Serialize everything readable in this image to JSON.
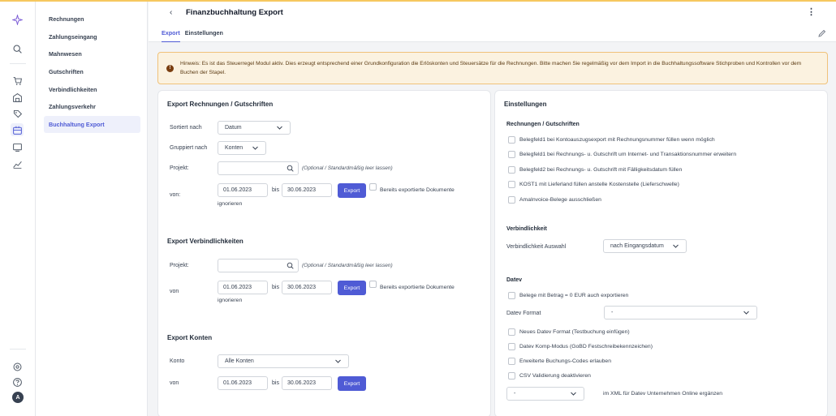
{
  "sidebar": {
    "items": [
      "Rechnungen",
      "Zahlungseingang",
      "Mahnwesen",
      "Gutschriften",
      "Verbindlichkeiten",
      "Zahlungsverkehr",
      "Buchhaltung Export"
    ],
    "active_index": 6,
    "avatar_initial": "A"
  },
  "header": {
    "back": "‹",
    "title": "Finanzbuchhaltung Export",
    "menu": "⋮"
  },
  "tabs": [
    "Export",
    "Einstellungen"
  ],
  "hint": {
    "text": "Hinweis: Es ist das Steuerregel Modul aktiv. Dies erzeugt entsprechend einer Grundkonfiguration die Erlöskonten und Steuersätze für die Rechnungen. Bitte machen Sie regelmäßig vor dem Import in die Buchhaltungssoftware Stichproben und Kontrollen vor dem Buchen der Stapel."
  },
  "export_invoices": {
    "title": "Export Rechnungen / Gutschriften",
    "sort_label": "Sortiert nach",
    "sort_value": "Datum",
    "group_label": "Gruppiert nach",
    "group_value": "Konten",
    "project_label": "Projekt:",
    "project_hint": "(Optional / Standardmäßig leer lassen)",
    "from_label": "von:",
    "from_date": "01.06.2023",
    "to_label": "bis",
    "to_date": "30.06.2023",
    "export_button": "Export",
    "ignore_line1": "Bereits exportierte Dokumente",
    "ignore_line2": "ignorieren"
  },
  "export_liabilities": {
    "title": "Export Verbindlichkeiten",
    "project_label": "Projekt:",
    "project_hint": "(Optional / Standardmäßig leer lassen)",
    "from_label": "von",
    "from_date": "01.06.2023",
    "to_label": "bis",
    "to_date": "30.06.2023",
    "export_button": "Export",
    "ignore_line1": "Bereits exportierte Dokumente",
    "ignore_line2": "ignorieren"
  },
  "export_accounts": {
    "title": "Export Konten",
    "account_label": "Konto",
    "account_value": "Alle Konten",
    "from_label": "von",
    "from_date": "01.06.2023",
    "to_label": "bis",
    "to_date": "30.06.2023",
    "export_button": "Export"
  },
  "settings": {
    "title": "Einstellungen",
    "invoices_heading": "Rechnungen / Gutschriften",
    "invoice_options": [
      "Belegfeld1 bei Kontoauszugsexport mit Rechnungsnummer füllen wenn möglich",
      "Belegfeld1 bei Rechnungs- u. Gutschrift um Internet- und Transaktionsnummer erweitern",
      "Belegfeld2 bei Rechnungs- u. Gutschrift mit Fälligkeitsdatum füllen",
      "KOST1 mit Lieferland füllen anstelle Kostenstelle (Lieferschwelle)",
      "AmaInvoice-Belege ausschließen"
    ],
    "liability_heading": "Verbindlichkeit",
    "liability_label": "Verbindlichkeit Auswahl",
    "liability_value": "nach Eingangsdatum",
    "datev_heading": "Datev",
    "datev_zero": "Belege mit Betrag = 0 EUR auch exportieren",
    "datev_format_label": "Datev Format",
    "datev_format_value": "-",
    "datev_options": [
      "Neues Datev Format (Testbuchung einfügen)",
      "Datev Komp-Modus (GoBD Festschreibekennzeichen)",
      "Erweiterte Buchungs-Codes erlauben",
      "CSV Validierung deaktivieren"
    ],
    "xml_value": "-",
    "xml_label": "im XML für Datev Unternehmen Online ergänzen"
  }
}
